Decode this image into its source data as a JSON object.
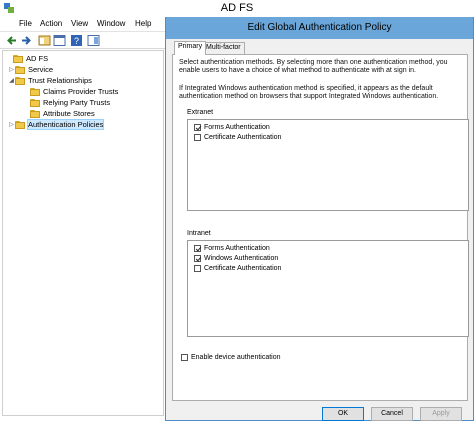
{
  "window": {
    "title": "AD FS",
    "menu": [
      "File",
      "Action",
      "View",
      "Window",
      "Help"
    ]
  },
  "toolbar": {
    "icons": [
      "back-arrow-icon",
      "forward-arrow-icon",
      "console-tree-icon",
      "properties-icon",
      "help-icon",
      "show-hide-pane-icon"
    ]
  },
  "tree": {
    "root": "AD FS",
    "items": [
      {
        "label": "Service",
        "level": 1,
        "expander": "▷"
      },
      {
        "label": "Trust Relationships",
        "level": 1,
        "expander": "◢"
      },
      {
        "label": "Claims Provider Trusts",
        "level": 2,
        "expander": ""
      },
      {
        "label": "Relying Party Trusts",
        "level": 2,
        "expander": ""
      },
      {
        "label": "Attribute Stores",
        "level": 2,
        "expander": ""
      },
      {
        "label": "Authentication Policies",
        "level": 1,
        "expander": "▷",
        "selected": true
      }
    ]
  },
  "dialog": {
    "title": "Edit Global Authentication Policy",
    "tabs": [
      "Primary",
      "Multi-factor"
    ],
    "intro": "Select authentication methods. By selecting more than one authentication method, you enable users to have a choice of what method to authenticate with at sign in.",
    "note": "If Integrated Windows authentication method is specified, it appears as the default authentication method on browsers that support Integrated Windows authentication.",
    "extranet": {
      "label": "Extranet",
      "options": [
        {
          "label": "Forms Authentication",
          "checked": true
        },
        {
          "label": "Certificate Authentication",
          "checked": false
        }
      ]
    },
    "intranet": {
      "label": "Intranet",
      "options": [
        {
          "label": "Forms Authentication",
          "checked": true
        },
        {
          "label": "Windows Authentication",
          "checked": true
        },
        {
          "label": "Certificate Authentication",
          "checked": false
        }
      ]
    },
    "device_auth": {
      "label": "Enable device authentication",
      "checked": false
    },
    "buttons": {
      "ok": "OK",
      "cancel": "Cancel",
      "apply": "Apply"
    }
  }
}
